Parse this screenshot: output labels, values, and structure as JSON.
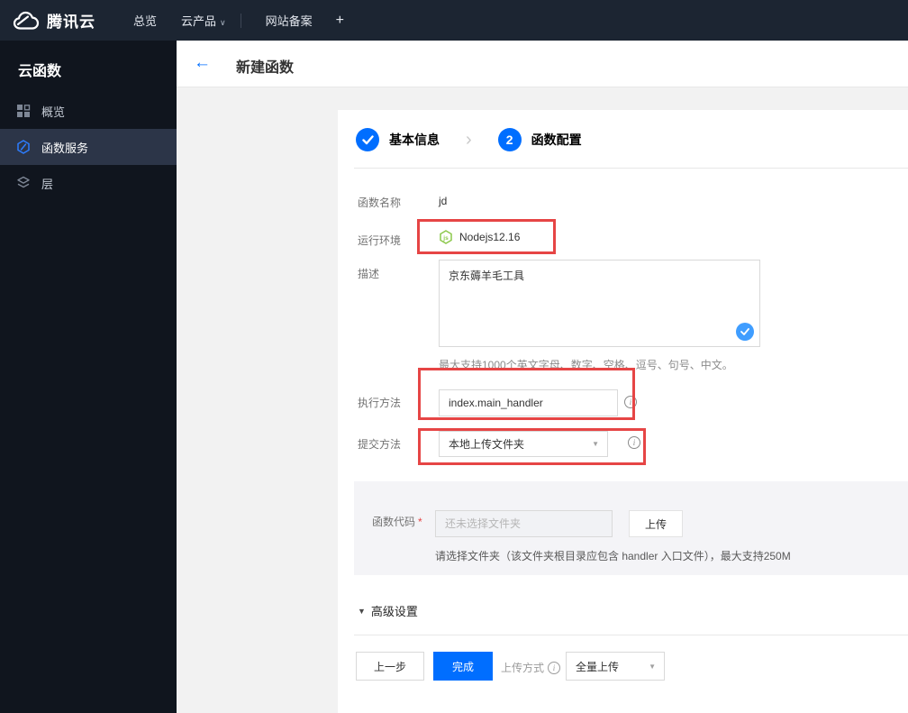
{
  "navbar": {
    "brand": "腾讯云",
    "menu": [
      {
        "label": "总览"
      },
      {
        "label": "云产品"
      },
      {
        "label": "网站备案"
      },
      {
        "label": "+"
      }
    ]
  },
  "sidebar": {
    "title": "云函数",
    "items": [
      {
        "label": "概览",
        "icon": "grid-icon",
        "active": false
      },
      {
        "label": "函数服务",
        "icon": "function-hexagon-icon",
        "active": true
      },
      {
        "label": "层",
        "icon": "layers-icon",
        "active": false
      }
    ]
  },
  "header": {
    "title": "新建函数"
  },
  "steps": [
    {
      "number": "✓",
      "label": "基本信息",
      "state": "done"
    },
    {
      "number": "2",
      "label": "函数配置",
      "state": "current"
    }
  ],
  "form": {
    "function_name": {
      "label": "函数名称",
      "value": "jd"
    },
    "runtime": {
      "label": "运行环境",
      "value": "Nodejs12.16",
      "icon": "nodejs-icon"
    },
    "description": {
      "label": "描述",
      "value": "京东薅羊毛工具",
      "hint": "最大支持1000个英文字母、数字、空格、逗号、句号、中文。"
    },
    "handler": {
      "label": "执行方法",
      "value": "index.main_handler"
    },
    "submit_method": {
      "label": "提交方法",
      "value": "本地上传文件夹"
    },
    "function_code": {
      "label": "函数代码",
      "required_mark": "*",
      "placeholder": "还未选择文件夹",
      "upload_button": "上传",
      "hint": "请选择文件夹（该文件夹根目录应包含 handler 入口文件），最大支持250M"
    },
    "advanced_label": "高级设置"
  },
  "footer": {
    "prev_button": "上一步",
    "finish_button": "完成",
    "upload_mode_label": "上传方式",
    "upload_mode_value": "全量上传"
  },
  "icons": {
    "back_arrow": "←",
    "nav_caret": "∨",
    "step_chevron": "›",
    "select_caret": "▼",
    "advanced_caret": "▼",
    "info": "i"
  },
  "colors": {
    "accent_blue": "#006eff",
    "annotation_red": "#e64545",
    "node_green": "#8cc84b",
    "check_blue": "#3f9dff",
    "navbar_bg": "#1c2532",
    "sidebar_bg": "#10151e",
    "sidebar_active_bg": "#2c3548",
    "body_gray": "#f2f2f2",
    "band_gray": "#f4f4f7"
  }
}
